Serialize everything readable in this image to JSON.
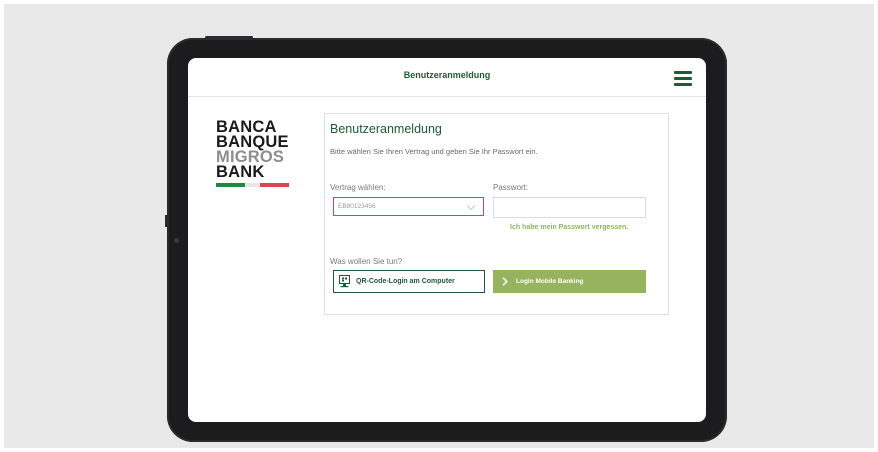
{
  "header": {
    "title": "Benutzeranmeldung"
  },
  "logo": {
    "lines": [
      "BANCA",
      "BANQUE",
      "MIGROS",
      "BANK"
    ],
    "stripe_colors": [
      "#1e8a3f",
      "#e6e6e6",
      "#d9464f"
    ]
  },
  "login": {
    "title": "Benutzeranmeldung",
    "intro": "Bitte wählen Sie Ihren Vertrag und geben Sie Ihr Passwort ein.",
    "contract_label": "Vertrag wählen:",
    "contract_value": "EB80123456",
    "password_label": "Passwort:",
    "password_value": "",
    "forgot_link": "Ich habe mein Passwort vergessen.",
    "action_prompt": "Was wollen Sie tun?",
    "qr_button_label": "QR-Code-Login am Computer",
    "mobile_button_label": "Login Mobile Banking"
  },
  "colors": {
    "brand_green": "#1e5b36",
    "accent_green": "#96b45e",
    "link_green": "#8fb657",
    "focus_pink": "#d83c77"
  },
  "icons": {
    "menu": "hamburger-menu-icon",
    "qr": "computer-qr-icon",
    "chevron": "chevron-right-icon",
    "dropdown": "chevron-down-icon"
  }
}
